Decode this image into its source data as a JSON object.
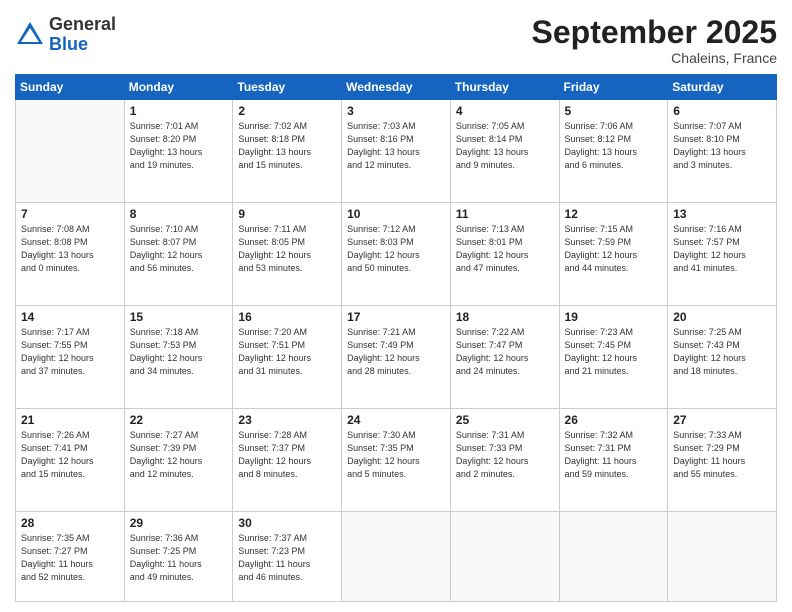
{
  "logo": {
    "general": "General",
    "blue": "Blue"
  },
  "title": "September 2025",
  "location": "Chaleins, France",
  "days_header": [
    "Sunday",
    "Monday",
    "Tuesday",
    "Wednesday",
    "Thursday",
    "Friday",
    "Saturday"
  ],
  "weeks": [
    [
      {
        "day": "",
        "info": ""
      },
      {
        "day": "1",
        "info": "Sunrise: 7:01 AM\nSunset: 8:20 PM\nDaylight: 13 hours\nand 19 minutes."
      },
      {
        "day": "2",
        "info": "Sunrise: 7:02 AM\nSunset: 8:18 PM\nDaylight: 13 hours\nand 15 minutes."
      },
      {
        "day": "3",
        "info": "Sunrise: 7:03 AM\nSunset: 8:16 PM\nDaylight: 13 hours\nand 12 minutes."
      },
      {
        "day": "4",
        "info": "Sunrise: 7:05 AM\nSunset: 8:14 PM\nDaylight: 13 hours\nand 9 minutes."
      },
      {
        "day": "5",
        "info": "Sunrise: 7:06 AM\nSunset: 8:12 PM\nDaylight: 13 hours\nand 6 minutes."
      },
      {
        "day": "6",
        "info": "Sunrise: 7:07 AM\nSunset: 8:10 PM\nDaylight: 13 hours\nand 3 minutes."
      }
    ],
    [
      {
        "day": "7",
        "info": "Sunrise: 7:08 AM\nSunset: 8:08 PM\nDaylight: 13 hours\nand 0 minutes."
      },
      {
        "day": "8",
        "info": "Sunrise: 7:10 AM\nSunset: 8:07 PM\nDaylight: 12 hours\nand 56 minutes."
      },
      {
        "day": "9",
        "info": "Sunrise: 7:11 AM\nSunset: 8:05 PM\nDaylight: 12 hours\nand 53 minutes."
      },
      {
        "day": "10",
        "info": "Sunrise: 7:12 AM\nSunset: 8:03 PM\nDaylight: 12 hours\nand 50 minutes."
      },
      {
        "day": "11",
        "info": "Sunrise: 7:13 AM\nSunset: 8:01 PM\nDaylight: 12 hours\nand 47 minutes."
      },
      {
        "day": "12",
        "info": "Sunrise: 7:15 AM\nSunset: 7:59 PM\nDaylight: 12 hours\nand 44 minutes."
      },
      {
        "day": "13",
        "info": "Sunrise: 7:16 AM\nSunset: 7:57 PM\nDaylight: 12 hours\nand 41 minutes."
      }
    ],
    [
      {
        "day": "14",
        "info": "Sunrise: 7:17 AM\nSunset: 7:55 PM\nDaylight: 12 hours\nand 37 minutes."
      },
      {
        "day": "15",
        "info": "Sunrise: 7:18 AM\nSunset: 7:53 PM\nDaylight: 12 hours\nand 34 minutes."
      },
      {
        "day": "16",
        "info": "Sunrise: 7:20 AM\nSunset: 7:51 PM\nDaylight: 12 hours\nand 31 minutes."
      },
      {
        "day": "17",
        "info": "Sunrise: 7:21 AM\nSunset: 7:49 PM\nDaylight: 12 hours\nand 28 minutes."
      },
      {
        "day": "18",
        "info": "Sunrise: 7:22 AM\nSunset: 7:47 PM\nDaylight: 12 hours\nand 24 minutes."
      },
      {
        "day": "19",
        "info": "Sunrise: 7:23 AM\nSunset: 7:45 PM\nDaylight: 12 hours\nand 21 minutes."
      },
      {
        "day": "20",
        "info": "Sunrise: 7:25 AM\nSunset: 7:43 PM\nDaylight: 12 hours\nand 18 minutes."
      }
    ],
    [
      {
        "day": "21",
        "info": "Sunrise: 7:26 AM\nSunset: 7:41 PM\nDaylight: 12 hours\nand 15 minutes."
      },
      {
        "day": "22",
        "info": "Sunrise: 7:27 AM\nSunset: 7:39 PM\nDaylight: 12 hours\nand 12 minutes."
      },
      {
        "day": "23",
        "info": "Sunrise: 7:28 AM\nSunset: 7:37 PM\nDaylight: 12 hours\nand 8 minutes."
      },
      {
        "day": "24",
        "info": "Sunrise: 7:30 AM\nSunset: 7:35 PM\nDaylight: 12 hours\nand 5 minutes."
      },
      {
        "day": "25",
        "info": "Sunrise: 7:31 AM\nSunset: 7:33 PM\nDaylight: 12 hours\nand 2 minutes."
      },
      {
        "day": "26",
        "info": "Sunrise: 7:32 AM\nSunset: 7:31 PM\nDaylight: 11 hours\nand 59 minutes."
      },
      {
        "day": "27",
        "info": "Sunrise: 7:33 AM\nSunset: 7:29 PM\nDaylight: 11 hours\nand 55 minutes."
      }
    ],
    [
      {
        "day": "28",
        "info": "Sunrise: 7:35 AM\nSunset: 7:27 PM\nDaylight: 11 hours\nand 52 minutes."
      },
      {
        "day": "29",
        "info": "Sunrise: 7:36 AM\nSunset: 7:25 PM\nDaylight: 11 hours\nand 49 minutes."
      },
      {
        "day": "30",
        "info": "Sunrise: 7:37 AM\nSunset: 7:23 PM\nDaylight: 11 hours\nand 46 minutes."
      },
      {
        "day": "",
        "info": ""
      },
      {
        "day": "",
        "info": ""
      },
      {
        "day": "",
        "info": ""
      },
      {
        "day": "",
        "info": ""
      }
    ]
  ]
}
